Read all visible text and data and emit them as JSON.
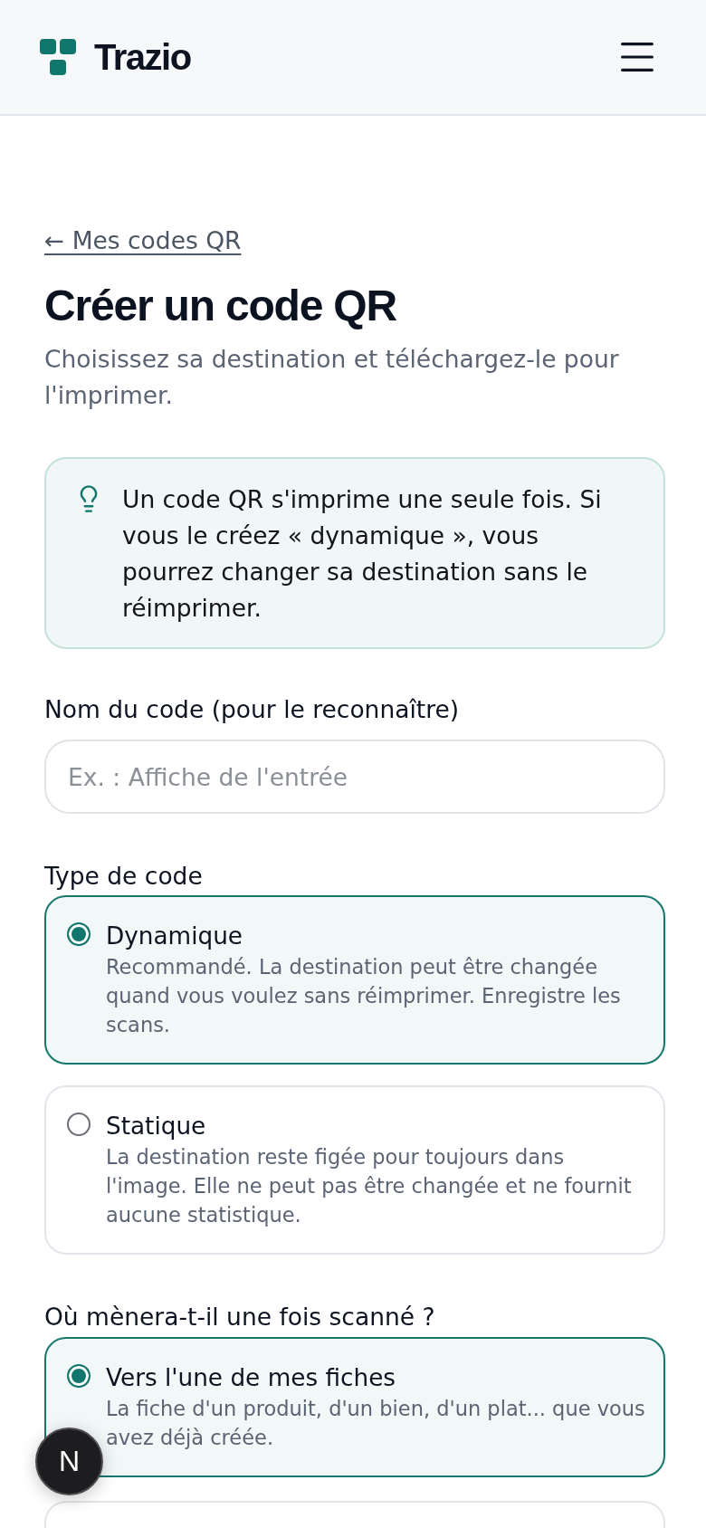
{
  "header": {
    "brand": "Trazio"
  },
  "back_link": {
    "label": "← Mes codes QR"
  },
  "title": "Créer un code QR",
  "subtitle": "Choisissez sa destination et téléchargez-le pour l'imprimer.",
  "tip": {
    "text": "Un code QR s'imprime une seule fois. Si vous le créez « dynamique », vous pourrez changer sa destination sans le réimprimer."
  },
  "name_field": {
    "label": "Nom du code (pour le reconnaître)",
    "placeholder": "Ex. : Affiche de l'entrée"
  },
  "code_type": {
    "label": "Type de code",
    "options": [
      {
        "title": "Dynamique",
        "description": "Recommandé. La destination peut être changée quand vous voulez sans réimprimer. Enregistre les scans.",
        "selected": true
      },
      {
        "title": "Statique",
        "description": "La destination reste figée pour toujours dans l'image. Elle ne peut pas être changée et ne fournit aucune statistique.",
        "selected": false
      }
    ]
  },
  "destination": {
    "label": "Où mènera-t-il une fois scanné ?",
    "options": [
      {
        "title": "Vers l'une de mes fiches",
        "description": "La fiche d'un produit, d'un bien, d'un plat... que vous avez déjà créée.",
        "selected": true
      },
      {
        "selected": false
      }
    ]
  },
  "dev_badge": {
    "label": "N"
  }
}
